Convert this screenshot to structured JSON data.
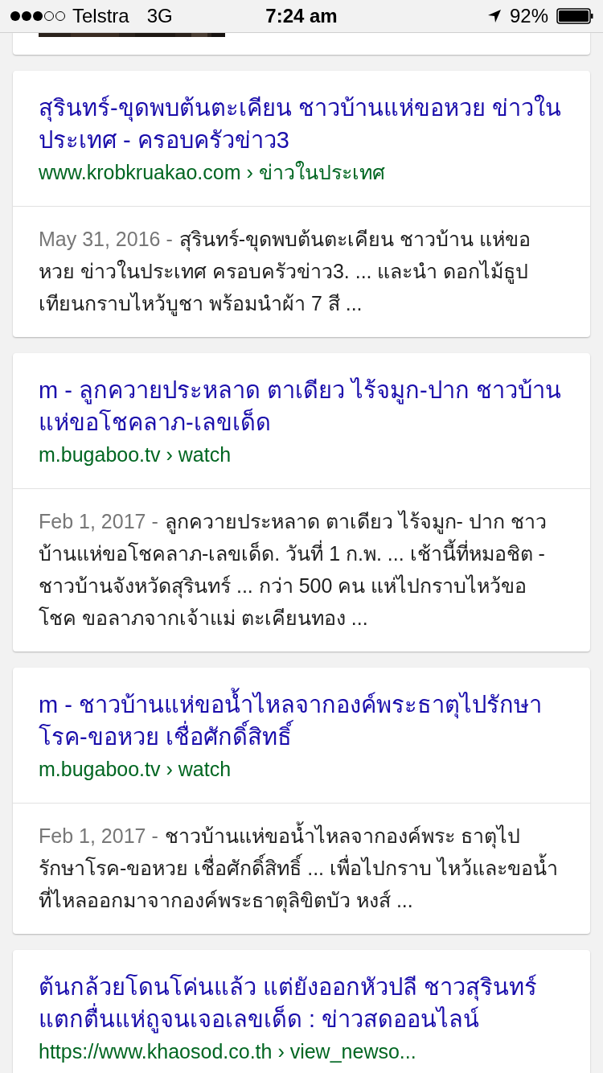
{
  "status_bar": {
    "carrier": "Telstra",
    "network": "3G",
    "time": "7:24 am",
    "battery": "92%"
  },
  "results": [
    {
      "title": "สุรินทร์-ขุดพบต้นตะเคียน ชาวบ้านแห่ขอหวย ข่าวในประเทศ - ครอบครัวข่าว3",
      "url": "www.krobkruakao.com",
      "path": "› ข่าวในประเทศ",
      "date": "May 31, 2016 -",
      "snippet": "สุรินทร์-ขุดพบต้นตะเคียน ชาวบ้าน แห่ขอหวย ข่าวในประเทศ ครอบครัวข่าว3. ... และนำ ดอกไม้ธูปเทียนกราบไหว้บูชา พร้อมนำผ้า 7 สี ..."
    },
    {
      "title": "m - ลูกควายประหลาด ตาเดียว ไร้จมูก-ปาก ชาวบ้านแห่ขอโชคลาภ-เลขเด็ด",
      "url": "m.bugaboo.tv",
      "path": "› watch",
      "date": "Feb 1, 2017 -",
      "snippet": "ลูกควายประหลาด ตาเดียว ไร้จมูก- ปาก ชาวบ้านแห่ขอโชคลาภ-เลขเด็ด. วันที่ 1 ก.พ. ... เช้านี้ที่หมอชิต - ชาวบ้านจังหวัดสุรินทร์ ... กว่า 500 คน แห่ไปกราบไหว้ขอโชค ขอลาภจากเจ้าแม่ ตะเคียนทอง ..."
    },
    {
      "title": "m - ชาวบ้านแห่ขอน้ำไหลจากองค์พระธาตุไปรักษาโรค-ขอหวย เชื่อศักดิ์สิทธิ์",
      "url": "m.bugaboo.tv",
      "path": "› watch",
      "date": "Feb 1, 2017 -",
      "snippet": "ชาวบ้านแห่ขอน้ำไหลจากองค์พระ ธาตุไปรักษาโรค-ขอหวย เชื่อศักดิ์สิทธิ์ ... เพื่อไปกราบ ไหว้และขอน้ำที่ไหลออกมาจากองค์พระธาตุลิขิตบัว หงส์ ..."
    },
    {
      "title": "ต้นกล้วยโดนโค่นแล้ว แต่ยังออกหัวปลี ชาวสุรินทร์แตกตื่นแห่ถูจนเจอเลขเด็ด : ข่าวสดออนไลน์",
      "url": "https://www.khaosod.co.th",
      "path": "› view_newso..."
    }
  ]
}
